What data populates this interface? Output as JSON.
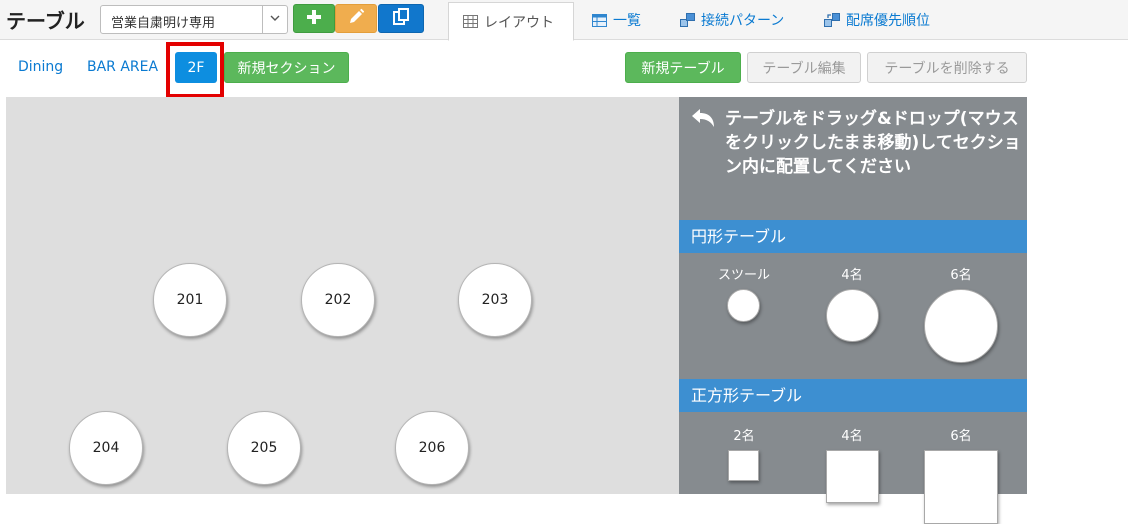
{
  "header": {
    "title": "テーブル",
    "business_select": {
      "value": "営業自粛明け専用"
    },
    "tabs": [
      {
        "label": "レイアウト",
        "icon": "grid-icon"
      },
      {
        "label": "一覧",
        "icon": "table-list-icon"
      },
      {
        "label": "接続パターン",
        "icon": "connect-pattern-icon"
      },
      {
        "label": "配席優先順位",
        "icon": "seat-priority-icon"
      }
    ]
  },
  "sections": {
    "items": [
      {
        "label": "Dining"
      },
      {
        "label": "BAR AREA"
      },
      {
        "label": "2F"
      }
    ],
    "new_section_label": "新規セクション"
  },
  "actions": {
    "new_table_label": "新規テーブル",
    "edit_table_label": "テーブル編集",
    "delete_table_label": "テーブルを削除する"
  },
  "canvas": {
    "tables": [
      {
        "label": "201"
      },
      {
        "label": "202"
      },
      {
        "label": "203"
      },
      {
        "label": "204"
      },
      {
        "label": "205"
      },
      {
        "label": "206"
      }
    ]
  },
  "panel": {
    "instruction": "テーブルをドラッグ&ドロップ(マウスをクリックしたまま移動)してセクション内に配置してください",
    "round_header": "円形テーブル",
    "round_items": [
      {
        "label": "スツール"
      },
      {
        "label": "4名"
      },
      {
        "label": "6名"
      }
    ],
    "square_header": "正方形テーブル",
    "square_items": [
      {
        "label": "2名"
      },
      {
        "label": "4名"
      },
      {
        "label": "6名"
      }
    ]
  },
  "colors": {
    "accent_blue": "#0d8ee0",
    "green": "#5cb85c",
    "highlight_red": "#e30000",
    "panel_gray": "#868b8f",
    "panel_header": "#3d8fd1"
  }
}
